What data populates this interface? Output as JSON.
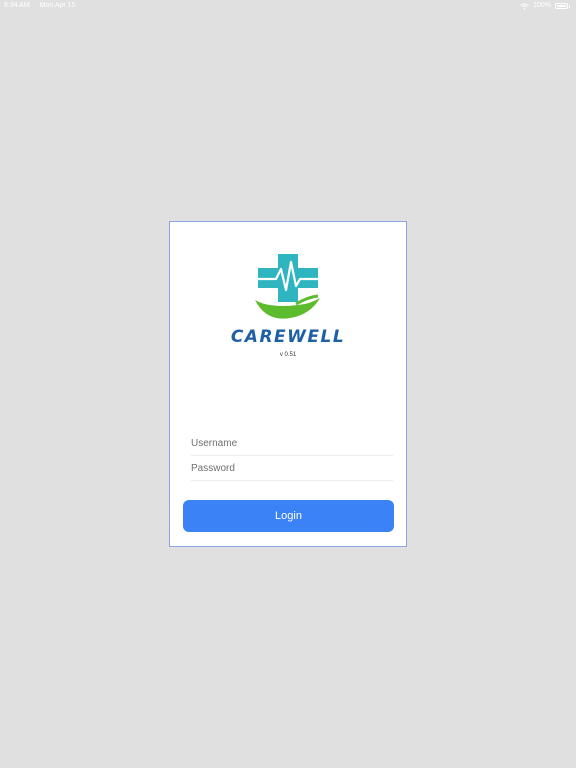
{
  "status_bar": {
    "time": "8:34 AM",
    "date": "Mon Apr 15",
    "battery": "100%"
  },
  "app": {
    "brand": "CAREWELL",
    "version": "v 0.51"
  },
  "form": {
    "username_placeholder": "Username",
    "password_placeholder": "Password",
    "login_label": "Login"
  },
  "colors": {
    "background": "#e0e0e0",
    "accent": "#3b82f6",
    "brand": "#1f5fa6",
    "logo_cross": "#2fb5c0",
    "logo_hand": "#5dbb2e"
  }
}
